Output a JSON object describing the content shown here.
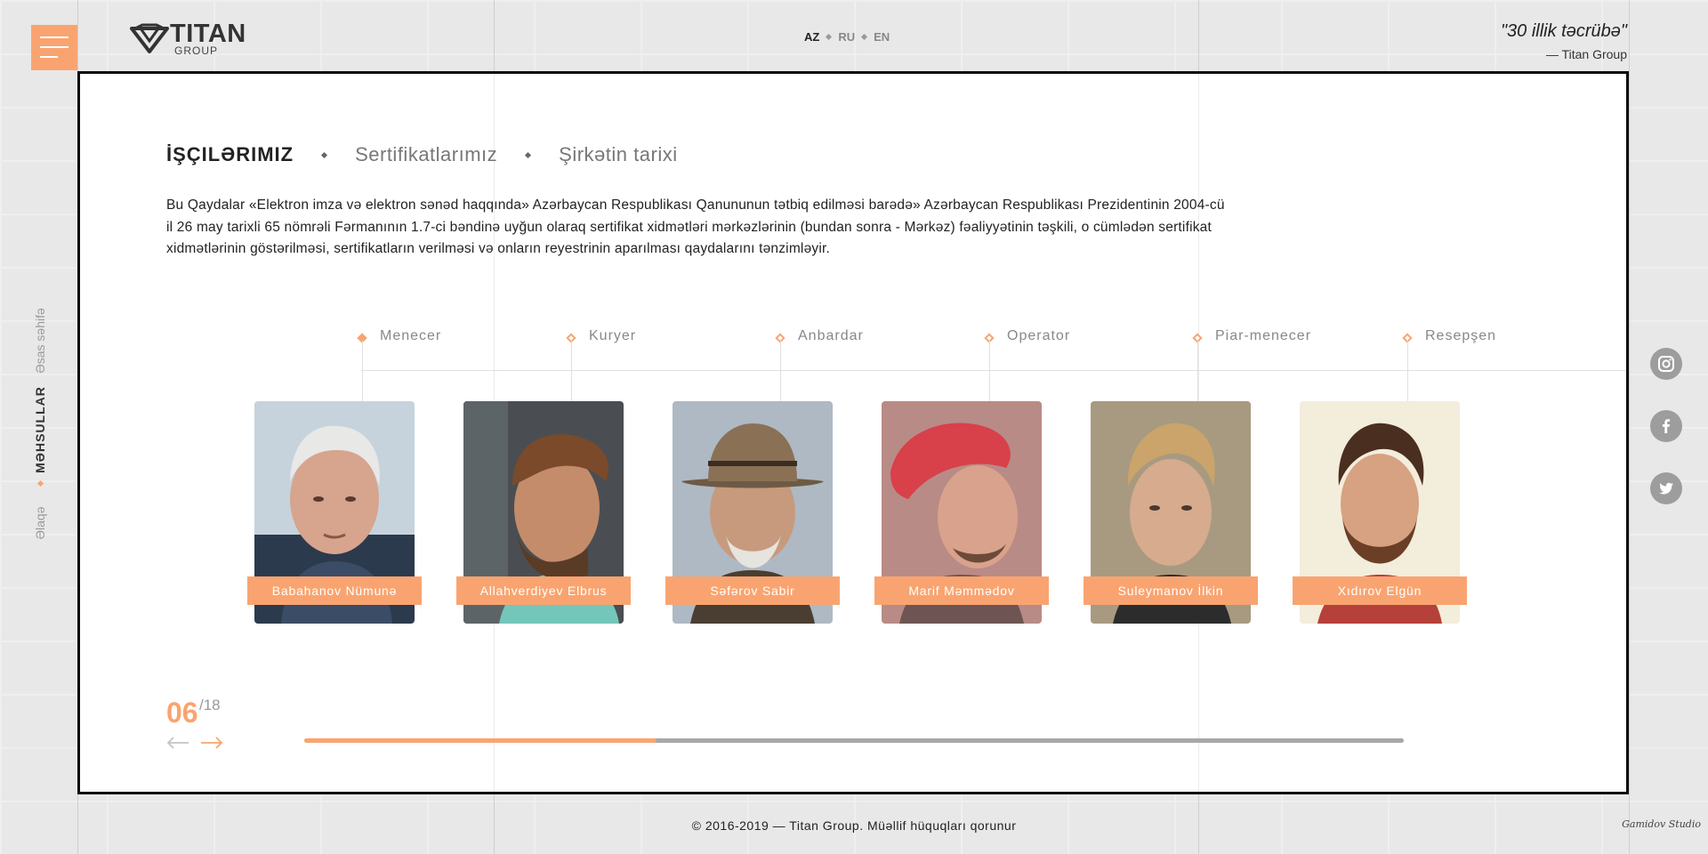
{
  "header": {
    "logo": {
      "title": "TITAN",
      "subtitle": "GROUP"
    },
    "languages": [
      {
        "code": "AZ",
        "active": true
      },
      {
        "code": "RU",
        "active": false
      },
      {
        "code": "EN",
        "active": false
      }
    ],
    "quote": {
      "text": "\"30 illik təcrübə\"",
      "author": "— Titan Group"
    }
  },
  "side_nav": {
    "items": [
      "Əsas səhifə",
      "MƏHSULLAR",
      "Əlaqə"
    ]
  },
  "social": [
    "instagram-icon",
    "facebook-icon",
    "twitter-icon"
  ],
  "main": {
    "tabs": [
      "İŞÇILƏRIMIZ",
      "Sertifikatlarımız",
      "Şirkətin tarixi"
    ],
    "intro": "Bu Qaydalar «Elektron imza və elektron sənəd haqqında» Azərbaycan Respublikası Qanununun tətbiq edilməsi barədə» Azərbaycan Respublikası Prezidentinin 2004-cü il 26 may tarixli 65 nömrəli Fərmanının 1.7-ci bəndinə uyğun olaraq sertifikat xidmətləri mərkəzlərinin (bundan sonra - Mərkəz) fəaliyyətinin təşkili, o cümlədən sertifikat xidmətlərinin göstərilməsi, sertifikatların verilməsi və onların reyestrinin aparılması qaydalarını tənzimləyir.",
    "employees": [
      {
        "role": "Menecer",
        "name": "Babahanov Nümunə"
      },
      {
        "role": "Kuryer",
        "name": "Allahverdiyev Elbrus"
      },
      {
        "role": "Anbardar",
        "name": "Səfərov Sabir"
      },
      {
        "role": "Operator",
        "name": "Marif Məmmədov"
      },
      {
        "role": "Piar-menecer",
        "name": "Suleymanov İlkin"
      },
      {
        "role": "Resepşen",
        "name": "Xıdırov Elgün"
      }
    ],
    "counter": {
      "current": "06",
      "total": "/18"
    },
    "progress": 0.32
  },
  "footer": {
    "copyright": "© 2016-2019 — Titan Group. Müəllif hüquqları qorunur",
    "studio": "Gamidov Studio"
  },
  "colors": {
    "accent": "#f9a470",
    "card_border": "#0a0a0a"
  }
}
